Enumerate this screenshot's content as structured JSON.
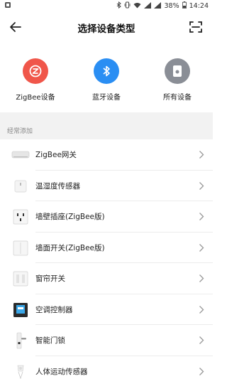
{
  "status_bar": {
    "battery": "38%",
    "time": "14:24"
  },
  "header": {
    "title": "选择设备类型"
  },
  "quick_types": [
    {
      "label": "ZigBee设备",
      "color": "#f0564a",
      "icon": "zigbee-icon"
    },
    {
      "label": "蓝牙设备",
      "color": "#2a8ef3",
      "icon": "bluetooth-icon"
    },
    {
      "label": "所有设备",
      "color": "#8a8e96",
      "icon": "all-devices-icon"
    }
  ],
  "section": {
    "label": "经常添加"
  },
  "devices": [
    {
      "label": "ZigBee网关",
      "icon": "gateway-icon"
    },
    {
      "label": "温湿度传感器",
      "icon": "humidity-sensor-icon"
    },
    {
      "label": "墙壁插座(ZigBee版)",
      "icon": "wall-socket-icon"
    },
    {
      "label": "墙面开关(ZigBee版)",
      "icon": "wall-switch-icon"
    },
    {
      "label": "窗帘开关",
      "icon": "curtain-switch-icon"
    },
    {
      "label": "空调控制器",
      "icon": "ac-controller-icon"
    },
    {
      "label": "智能门锁",
      "icon": "door-lock-icon"
    },
    {
      "label": "人体运动传感器",
      "icon": "motion-sensor-icon"
    }
  ]
}
